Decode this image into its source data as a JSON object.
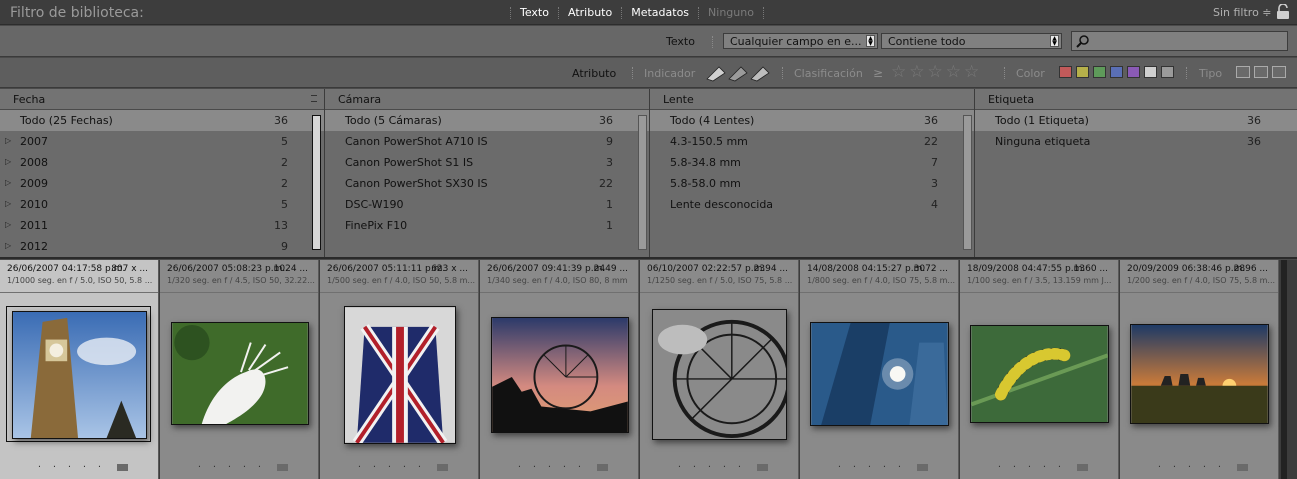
{
  "top": {
    "title": "Filtro de biblioteca:",
    "modes": [
      {
        "label": "Texto",
        "active": true
      },
      {
        "label": "Atributo",
        "active": true
      },
      {
        "label": "Metadatos",
        "active": true
      },
      {
        "label": "Ninguno",
        "active": false
      }
    ],
    "preset": "Sin filtro ≑"
  },
  "textbar": {
    "label": "Texto",
    "field_value": "Cualquier campo en e...",
    "rule_value": "Contiene todo",
    "search_value": ""
  },
  "attrbar": {
    "label": "Atributo",
    "flag_label": "Indicador",
    "rating_label": "Clasificación",
    "rating_op": "≥",
    "color_label": "Color",
    "type_label": "Tipo",
    "colors": [
      "#c25a5a",
      "#b5b04a",
      "#5e9a5a",
      "#5a6fb5",
      "#8a5ab5",
      "#cfcfcf",
      "#9a9a9a"
    ]
  },
  "columns": [
    {
      "header": "Fecha",
      "rows": [
        {
          "label": "Todo (25 Fechas)",
          "count": "36",
          "expandable": false,
          "selected": true
        },
        {
          "label": "2007",
          "count": "5",
          "expandable": true
        },
        {
          "label": "2008",
          "count": "2",
          "expandable": true
        },
        {
          "label": "2009",
          "count": "2",
          "expandable": true
        },
        {
          "label": "2010",
          "count": "5",
          "expandable": true
        },
        {
          "label": "2011",
          "count": "13",
          "expandable": true
        },
        {
          "label": "2012",
          "count": "9",
          "expandable": true
        }
      ]
    },
    {
      "header": "Cámara",
      "rows": [
        {
          "label": "Todo (5 Cámaras)",
          "count": "36",
          "selected": true
        },
        {
          "label": "Canon PowerShot A710 IS",
          "count": "9"
        },
        {
          "label": "Canon PowerShot S1 IS",
          "count": "3"
        },
        {
          "label": "Canon PowerShot SX30 IS",
          "count": "22"
        },
        {
          "label": "DSC-W190",
          "count": "1"
        },
        {
          "label": "FinePix F10",
          "count": "1"
        }
      ]
    },
    {
      "header": "Lente",
      "rows": [
        {
          "label": "Todo (4 Lentes)",
          "count": "36",
          "selected": true
        },
        {
          "label": "4.3-150.5 mm",
          "count": "22"
        },
        {
          "label": "5.8-34.8 mm",
          "count": "7"
        },
        {
          "label": "5.8-58.0 mm",
          "count": "3"
        },
        {
          "label": "Lente desconocida",
          "count": "4"
        }
      ]
    },
    {
      "header": "Etiqueta",
      "rows": [
        {
          "label": "Todo (1 Etiqueta)",
          "count": "36",
          "selected": true
        },
        {
          "label": "Ninguna etiqueta",
          "count": "36"
        }
      ]
    }
  ],
  "thumbs": [
    {
      "date": "26/06/2007 04:17:58 p.m.",
      "dim": "807 x ...",
      "exif": "1/1000 seg. en f / 5.0, ISO 50, 5.8 ...",
      "selected": true,
      "subject": "Big Ben tower"
    },
    {
      "date": "26/06/2007 05:08:23 p.m.",
      "dim": "1024 ...",
      "exif": "1/320 seg. en f / 4.5, ISO 50, 32.22...",
      "subject": "white pelican"
    },
    {
      "date": "26/06/2007 05:11:11 p.m.",
      "dim": "623 x ...",
      "exif": "1/500 seg. en f / 4.0, ISO 50, 5.8 m...",
      "subject": "union jack flag"
    },
    {
      "date": "26/06/2007 09:41:39 p.m.",
      "dim": "2449 ...",
      "exif": "1/340 seg. en f / 4.0, ISO 80, 8 mm",
      "subject": "London Eye sunset"
    },
    {
      "date": "06/10/2007 02:22:57 p.m.",
      "dim": "2394 ...",
      "exif": "1/1250 seg. en f / 5.0, ISO 75, 5.8 ...",
      "subject": "Ferris wheel black and white"
    },
    {
      "date": "14/08/2008 04:15:27 p.m.",
      "dim": "3072 ...",
      "exif": "1/800 seg. en f / 4.0, ISO 75, 5.8 m...",
      "subject": "glass skyscraper"
    },
    {
      "date": "18/09/2008 04:47:55 p.m.",
      "dim": "1360 ...",
      "exif": "1/100 seg. en f / 3.5, 13.159 mm J...",
      "subject": "caterpillar"
    },
    {
      "date": "20/09/2009 06:38:46 p.m.",
      "dim": "2896 ...",
      "exif": "1/200 seg. en f / 4.0, ISO 75, 5.8 m...",
      "subject": "Stonehenge sunset"
    }
  ]
}
